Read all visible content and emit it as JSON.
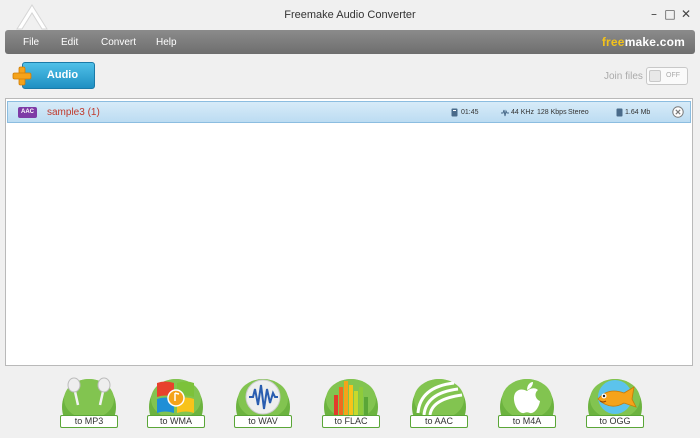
{
  "window": {
    "title": "Freemake Audio Converter",
    "controls": {
      "minimize": "–",
      "maximize": "□",
      "close": "✕"
    }
  },
  "menu": {
    "items": [
      {
        "id": "file",
        "label": "File"
      },
      {
        "id": "edit",
        "label": "Edit"
      },
      {
        "id": "convert",
        "label": "Convert"
      },
      {
        "id": "help",
        "label": "Help"
      }
    ],
    "brand": {
      "part1": "free",
      "part2": "make.com"
    }
  },
  "toolbar": {
    "audio_button": "Audio",
    "join_label": "Join files",
    "join_toggle_text": "OFF"
  },
  "files": [
    {
      "format": "AAC",
      "name": "sample3 (1)",
      "duration": "01:45",
      "sample_rate": "44 KHz",
      "bitrate": "128 Kbps",
      "channels": "Stereo",
      "size": "1.64 Mb"
    }
  ],
  "formats": [
    {
      "id": "mp3",
      "label": "to MP3",
      "icon": "headphones-icon"
    },
    {
      "id": "wma",
      "label": "to WMA",
      "icon": "windows-flag-icon"
    },
    {
      "id": "wav",
      "label": "to WAV",
      "icon": "waveform-icon"
    },
    {
      "id": "flac",
      "label": "to FLAC",
      "icon": "equalizer-icon"
    },
    {
      "id": "aac",
      "label": "to AAC",
      "icon": "aac-swoosh-icon"
    },
    {
      "id": "m4a",
      "label": "to M4A",
      "icon": "apple-icon"
    },
    {
      "id": "ogg",
      "label": "to OGG",
      "icon": "fish-icon"
    }
  ],
  "colors": {
    "accent_blue": "#2a9ed6",
    "format_green": "#5aa637",
    "aac_badge": "#7e3ba6",
    "file_name": "#c0392b",
    "brand_yellow": "#f2c21b"
  }
}
